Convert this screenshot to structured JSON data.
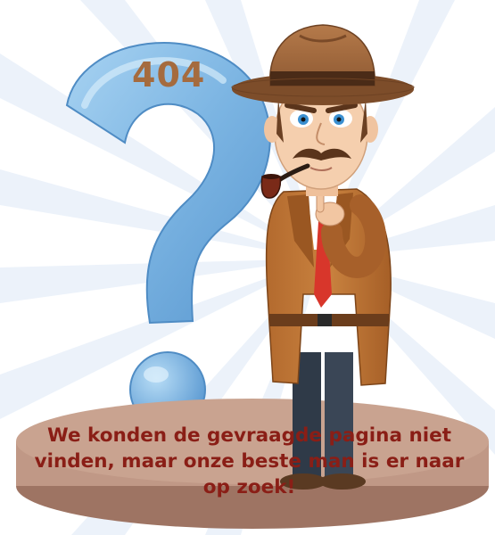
{
  "error_page": {
    "code": "404",
    "message": "We konden de gevraagde pagina niet vinden, maar onze beste man is er naar op zoek!"
  },
  "illustration": {
    "subject": "detective-icon",
    "question_mark": "question-mark-icon"
  },
  "colors": {
    "code_text": "#a56b3e",
    "message_text": "#8a1e16",
    "pedestal": "#c09886",
    "question_mark": "#79b2e0",
    "ray": "#e8f0fa"
  }
}
